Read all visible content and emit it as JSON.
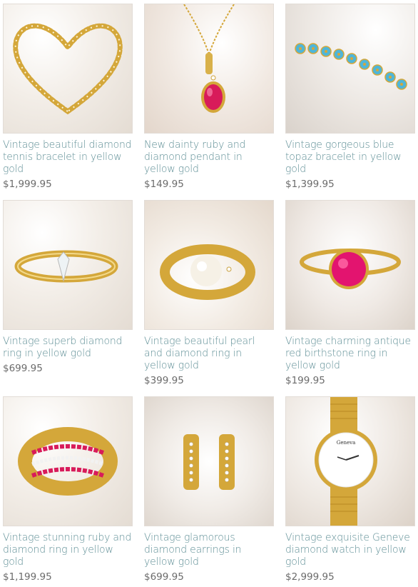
{
  "products": [
    {
      "title": "Vintage beautiful diamond tennis bracelet in yellow gold",
      "price": "$1,999.95",
      "icon": "heart-bracelet-icon"
    },
    {
      "title": "New dainty ruby and diamond pendant in yellow gold",
      "price": "$149.95",
      "icon": "ruby-pendant-icon"
    },
    {
      "title": "Vintage gorgeous blue topaz bracelet in yellow gold",
      "price": "$1,399.95",
      "icon": "topaz-bracelet-icon"
    },
    {
      "title": "Vintage superb diamond ring in yellow gold",
      "price": "$699.95",
      "icon": "diamond-ring-icon"
    },
    {
      "title": "Vintage beautiful pearl and diamond ring in yellow gold",
      "price": "$399.95",
      "icon": "pearl-ring-icon"
    },
    {
      "title": "Vintage charming antique red birthstone ring in yellow gold",
      "price": "$199.95",
      "icon": "red-ring-icon"
    },
    {
      "title": "Vintage stunning ruby and diamond ring in yellow gold",
      "price": "$1,199.95",
      "icon": "ruby-band-icon"
    },
    {
      "title": "Vintage glamorous diamond earrings in yellow gold",
      "price": "$699.95",
      "icon": "earrings-icon"
    },
    {
      "title": "Vintage exquisite Geneve diamond watch in yellow gold",
      "price": "$2,999.95",
      "icon": "watch-icon"
    }
  ],
  "watch_brand": "Geneva",
  "colors": {
    "title": "#5f8f96",
    "price": "#6b6b6b",
    "gold": "#d4a73a",
    "ruby": "#d81b5a",
    "topaz": "#4fb6d8"
  }
}
